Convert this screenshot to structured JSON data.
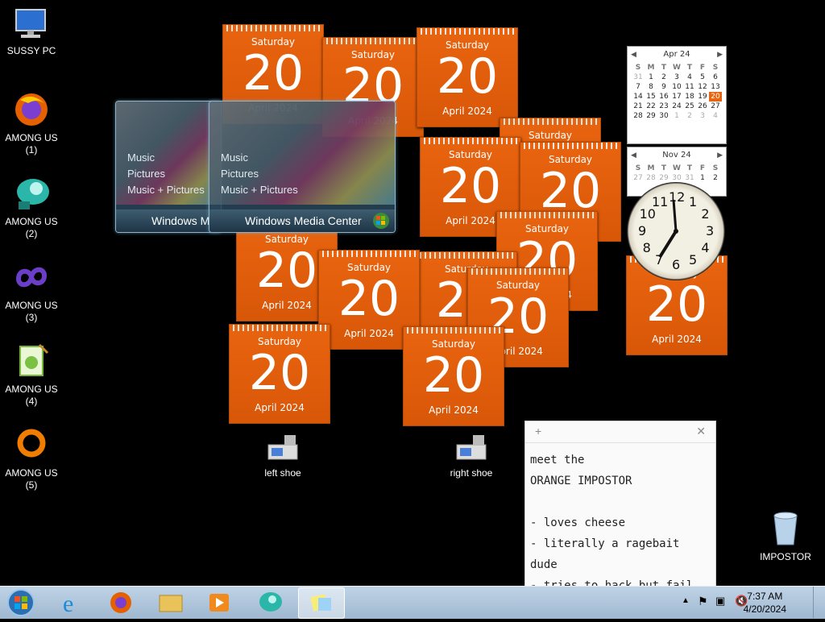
{
  "desktop_icons": [
    {
      "label": "SUSSY PC",
      "icon": "computer-icon"
    },
    {
      "label": "AMONG US\n(1)",
      "icon": "firefox-icon"
    },
    {
      "label": "AMONG US\n(2)",
      "icon": "teal-bird-icon"
    },
    {
      "label": "AMONG US\n(3)",
      "icon": "purple-infinity-icon"
    },
    {
      "label": "AMONG US\n(4)",
      "icon": "notepad-plus-icon"
    },
    {
      "label": "AMONG US\n(5)",
      "icon": "orange-ring-icon"
    }
  ],
  "shoe_icons": {
    "left": "left shoe",
    "right": "right shoe"
  },
  "recycle_bin": {
    "label": "IMPOSTOR"
  },
  "calendar_gadget": {
    "day": "Saturday",
    "date": "20",
    "month": "April 2024"
  },
  "media_center": {
    "menu": [
      "Music",
      "Pictures",
      "Music + Pictures"
    ],
    "title_short": "Windows M",
    "title": "Windows Media Center"
  },
  "mini_calendar_1": {
    "month": "Apr 24",
    "headers": [
      "S",
      "M",
      "T",
      "W",
      "T",
      "F",
      "S"
    ],
    "rows": [
      [
        "31",
        "1",
        "2",
        "3",
        "4",
        "5",
        "6"
      ],
      [
        "7",
        "8",
        "9",
        "10",
        "11",
        "12",
        "13"
      ],
      [
        "14",
        "15",
        "16",
        "17",
        "18",
        "19",
        "20"
      ],
      [
        "21",
        "22",
        "23",
        "24",
        "25",
        "26",
        "27"
      ],
      [
        "28",
        "29",
        "30",
        "1",
        "2",
        "3",
        "4"
      ]
    ]
  },
  "mini_calendar_2": {
    "month": "Nov 24",
    "headers": [
      "S",
      "M",
      "T",
      "W",
      "T",
      "F",
      "S"
    ],
    "rows": [
      [
        "27",
        "28",
        "29",
        "30",
        "31",
        "1",
        "2"
      ]
    ]
  },
  "clock_numbers": [
    "12",
    "1",
    "2",
    "3",
    "4",
    "5",
    "6",
    "7",
    "8",
    "9",
    "10",
    "11"
  ],
  "sticky_note": {
    "lines": [
      "meet the",
      "ORANGE IMPOSTOR",
      "",
      "- loves cheese",
      "- literally a ragebait dude",
      "- tries to hack but fail"
    ]
  },
  "taskbar": {
    "apps": [
      "start-orb-icon",
      "internet-explorer-icon",
      "firefox-icon",
      "file-explorer-icon",
      "media-player-icon",
      "teal-bird-icon",
      "sticky-notes-icon"
    ],
    "time": "7:37 AM",
    "date": "4/20/2024"
  }
}
